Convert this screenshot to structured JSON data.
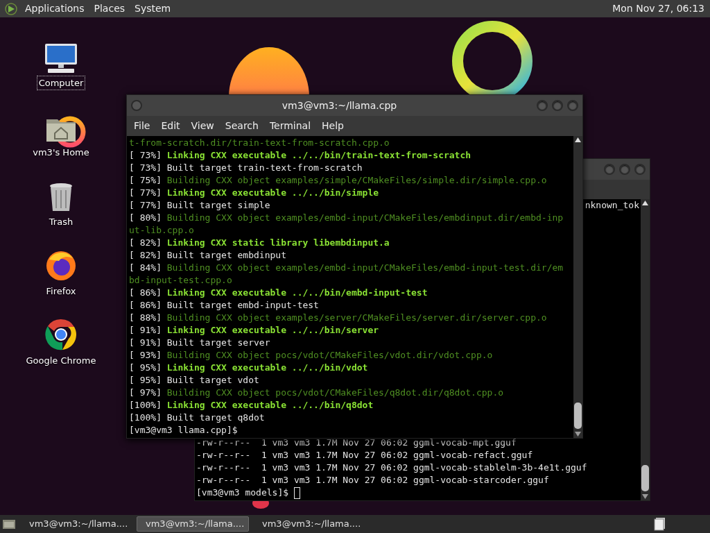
{
  "top_panel": {
    "menus": [
      {
        "label": "Applications"
      },
      {
        "label": "Places"
      },
      {
        "label": "System"
      }
    ],
    "clock": "Mon Nov 27, 06:13"
  },
  "desktop_icons": [
    {
      "kind": "computer",
      "label": "Computer",
      "selected": true
    },
    {
      "kind": "home",
      "label": "vm3's Home",
      "selected": false
    },
    {
      "kind": "trash",
      "label": "Trash",
      "selected": false
    },
    {
      "kind": "firefox",
      "label": "Firefox",
      "selected": false
    },
    {
      "kind": "chrome",
      "label": "Google Chrome",
      "selected": false
    }
  ],
  "back_terminal": {
    "top_lines": [
      {
        "kind": "plain",
        "text": "nknown_tok"
      }
    ],
    "bottom_lines": [
      {
        "kind": "plain",
        "text": "-rw-r--r--  1 vm3 vm3 1.7M Nov 27 06:02 ggml-vocab-mpt.gguf"
      },
      {
        "kind": "plain",
        "text": "-rw-r--r--  1 vm3 vm3 1.7M Nov 27 06:02 ggml-vocab-refact.gguf"
      },
      {
        "kind": "plain",
        "text": "-rw-r--r--  1 vm3 vm3 1.7M Nov 27 06:02 ggml-vocab-stablelm-3b-4e1t.gguf"
      },
      {
        "kind": "plain",
        "text": "-rw-r--r--  1 vm3 vm3 1.7M Nov 27 06:02 ggml-vocab-starcoder.gguf"
      },
      {
        "kind": "prompt",
        "text": "[vm3@vm3 models]$ "
      }
    ]
  },
  "front_terminal": {
    "title": "vm3@vm3:~/llama.cpp",
    "menu": [
      {
        "label": "File"
      },
      {
        "label": "Edit"
      },
      {
        "label": "View"
      },
      {
        "label": "Search"
      },
      {
        "label": "Terminal"
      },
      {
        "label": "Help"
      }
    ],
    "lines": [
      {
        "kind": "build",
        "text": "t-from-scratch.dir/train-text-from-scratch.cpp.o"
      },
      {
        "kind": "link",
        "prefix": "[ 73%] ",
        "text": "Linking CXX executable ../../bin/train-text-from-scratch"
      },
      {
        "kind": "plain",
        "text": "[ 73%] Built target train-text-from-scratch"
      },
      {
        "kind": "build",
        "prefix": "[ 75%] ",
        "text": "Building CXX object examples/simple/CMakeFiles/simple.dir/simple.cpp.o"
      },
      {
        "kind": "link",
        "prefix": "[ 77%] ",
        "text": "Linking CXX executable ../../bin/simple"
      },
      {
        "kind": "plain",
        "text": "[ 77%] Built target simple"
      },
      {
        "kind": "build",
        "prefix": "[ 80%] ",
        "text": "Building CXX object examples/embd-input/CMakeFiles/embdinput.dir/embd-inp"
      },
      {
        "kind": "build",
        "text": "ut-lib.cpp.o"
      },
      {
        "kind": "link",
        "prefix": "[ 82%] ",
        "text": "Linking CXX static library libembdinput.a"
      },
      {
        "kind": "plain",
        "text": "[ 82%] Built target embdinput"
      },
      {
        "kind": "build",
        "prefix": "[ 84%] ",
        "text": "Building CXX object examples/embd-input/CMakeFiles/embd-input-test.dir/em"
      },
      {
        "kind": "build",
        "text": "bd-input-test.cpp.o"
      },
      {
        "kind": "link",
        "prefix": "[ 86%] ",
        "text": "Linking CXX executable ../../bin/embd-input-test"
      },
      {
        "kind": "plain",
        "text": "[ 86%] Built target embd-input-test"
      },
      {
        "kind": "build",
        "prefix": "[ 88%] ",
        "text": "Building CXX object examples/server/CMakeFiles/server.dir/server.cpp.o"
      },
      {
        "kind": "link",
        "prefix": "[ 91%] ",
        "text": "Linking CXX executable ../../bin/server"
      },
      {
        "kind": "plain",
        "text": "[ 91%] Built target server"
      },
      {
        "kind": "build",
        "prefix": "[ 93%] ",
        "text": "Building CXX object pocs/vdot/CMakeFiles/vdot.dir/vdot.cpp.o"
      },
      {
        "kind": "link",
        "prefix": "[ 95%] ",
        "text": "Linking CXX executable ../../bin/vdot"
      },
      {
        "kind": "plain",
        "text": "[ 95%] Built target vdot"
      },
      {
        "kind": "build",
        "prefix": "[ 97%] ",
        "text": "Building CXX object pocs/vdot/CMakeFiles/q8dot.dir/q8dot.cpp.o"
      },
      {
        "kind": "link",
        "prefix": "[100%] ",
        "text": "Linking CXX executable ../../bin/q8dot"
      },
      {
        "kind": "plain",
        "text": "[100%] Built target q8dot"
      },
      {
        "kind": "plain",
        "text": "[vm3@vm3 llama.cpp]$"
      }
    ]
  },
  "taskbar": {
    "tasks": [
      {
        "label": "vm3@vm3:~/llama....",
        "selected": false
      },
      {
        "label": "vm3@vm3:~/llama....",
        "selected": true
      },
      {
        "label": "vm3@vm3:~/llama....",
        "selected": false
      }
    ]
  }
}
